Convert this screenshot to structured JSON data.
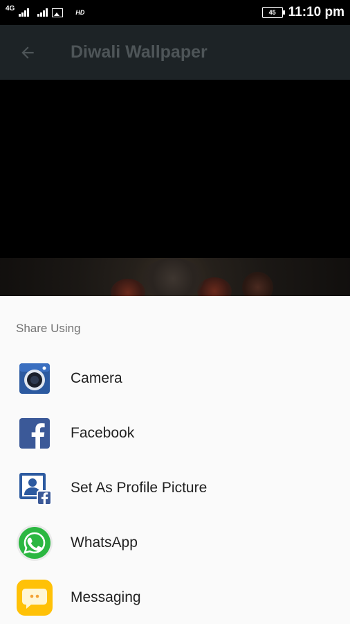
{
  "status_bar": {
    "network_1": "4G",
    "hd": "HD",
    "battery_level": "45",
    "time": "11:10 pm"
  },
  "app_bar": {
    "title": "Diwali Wallpaper"
  },
  "share_sheet": {
    "title": "Share Using",
    "items": [
      {
        "label": "Camera",
        "icon": "camera-icon"
      },
      {
        "label": "Facebook",
        "icon": "facebook-icon"
      },
      {
        "label": "Set As Profile Picture",
        "icon": "profile-picture-icon"
      },
      {
        "label": "WhatsApp",
        "icon": "whatsapp-icon"
      },
      {
        "label": "Messaging",
        "icon": "messaging-icon"
      }
    ]
  },
  "colors": {
    "app_bar": "#1d2326",
    "sheet_bg": "#fafafa",
    "facebook_blue": "#3b5998",
    "whatsapp_green": "#2bb741",
    "messaging_yellow": "#ffc107"
  }
}
